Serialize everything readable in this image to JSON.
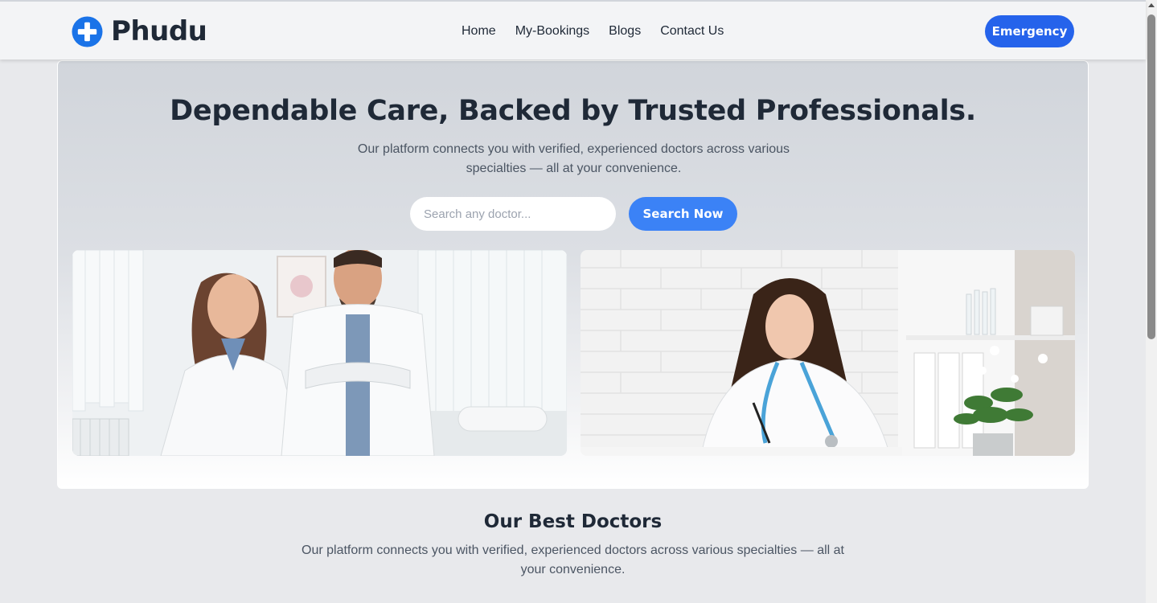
{
  "navbar": {
    "brand": "Phudu",
    "links": [
      "Home",
      "My-Bookings",
      "Blogs",
      "Contact Us"
    ],
    "emergency_label": "Emergency"
  },
  "hero": {
    "title": "Dependable Care, Backed by Trusted Professionals.",
    "subtitle": "Our platform connects you with verified, experienced doctors across various specialties — all at your convenience.",
    "search_placeholder": "Search any doctor...",
    "search_button": "Search Now"
  },
  "best_doctors": {
    "title": "Our Best Doctors",
    "subtitle": "Our platform connects you with verified, experienced doctors across various specialties — all at your convenience."
  },
  "colors": {
    "primary": "#2563eb",
    "button": "#3b82f6",
    "text": "#1f2937"
  }
}
